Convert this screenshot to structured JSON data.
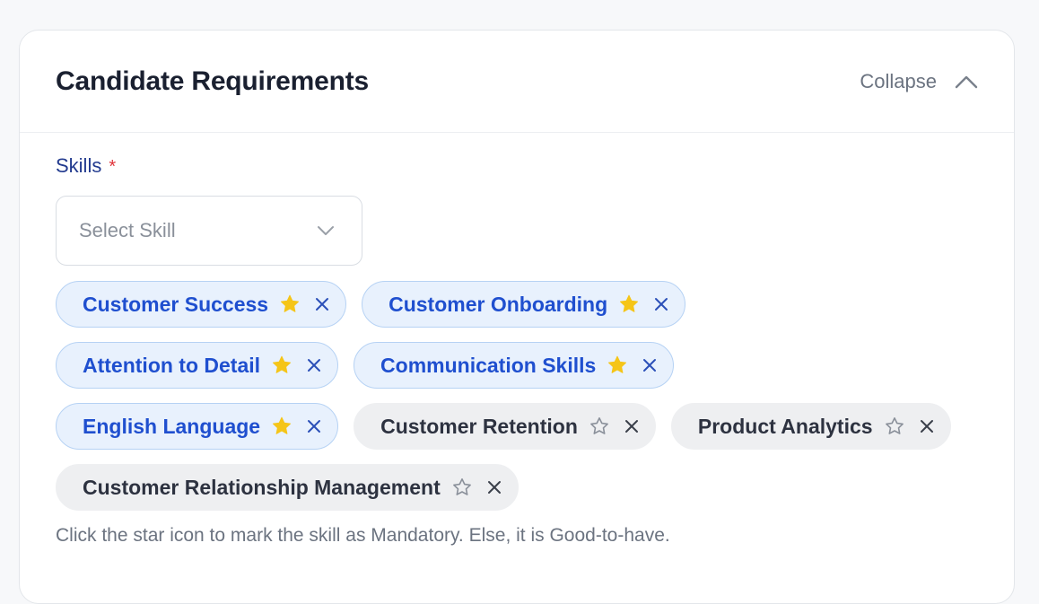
{
  "header": {
    "title": "Candidate Requirements",
    "collapse_label": "Collapse"
  },
  "skills": {
    "label": "Skills",
    "required_mark": "*",
    "select_placeholder": "Select Skill",
    "tags": [
      {
        "label": "Customer Success",
        "mandatory": true
      },
      {
        "label": "Customer Onboarding",
        "mandatory": true
      },
      {
        "label": "Attention to Detail",
        "mandatory": true
      },
      {
        "label": "Communication Skills",
        "mandatory": true
      },
      {
        "label": "English Language",
        "mandatory": true
      },
      {
        "label": "Customer Retention",
        "mandatory": false
      },
      {
        "label": "Product Analytics",
        "mandatory": false
      },
      {
        "label": "Customer Relationship Management",
        "mandatory": false
      }
    ],
    "hint": "Click the star icon to mark the skill as Mandatory. Else, it is Good-to-have."
  },
  "colors": {
    "mandatory_text": "#1f4fcf",
    "mandatory_bg": "#e8f1fd",
    "star_filled": "#f5c518",
    "required": "#e0333a"
  }
}
